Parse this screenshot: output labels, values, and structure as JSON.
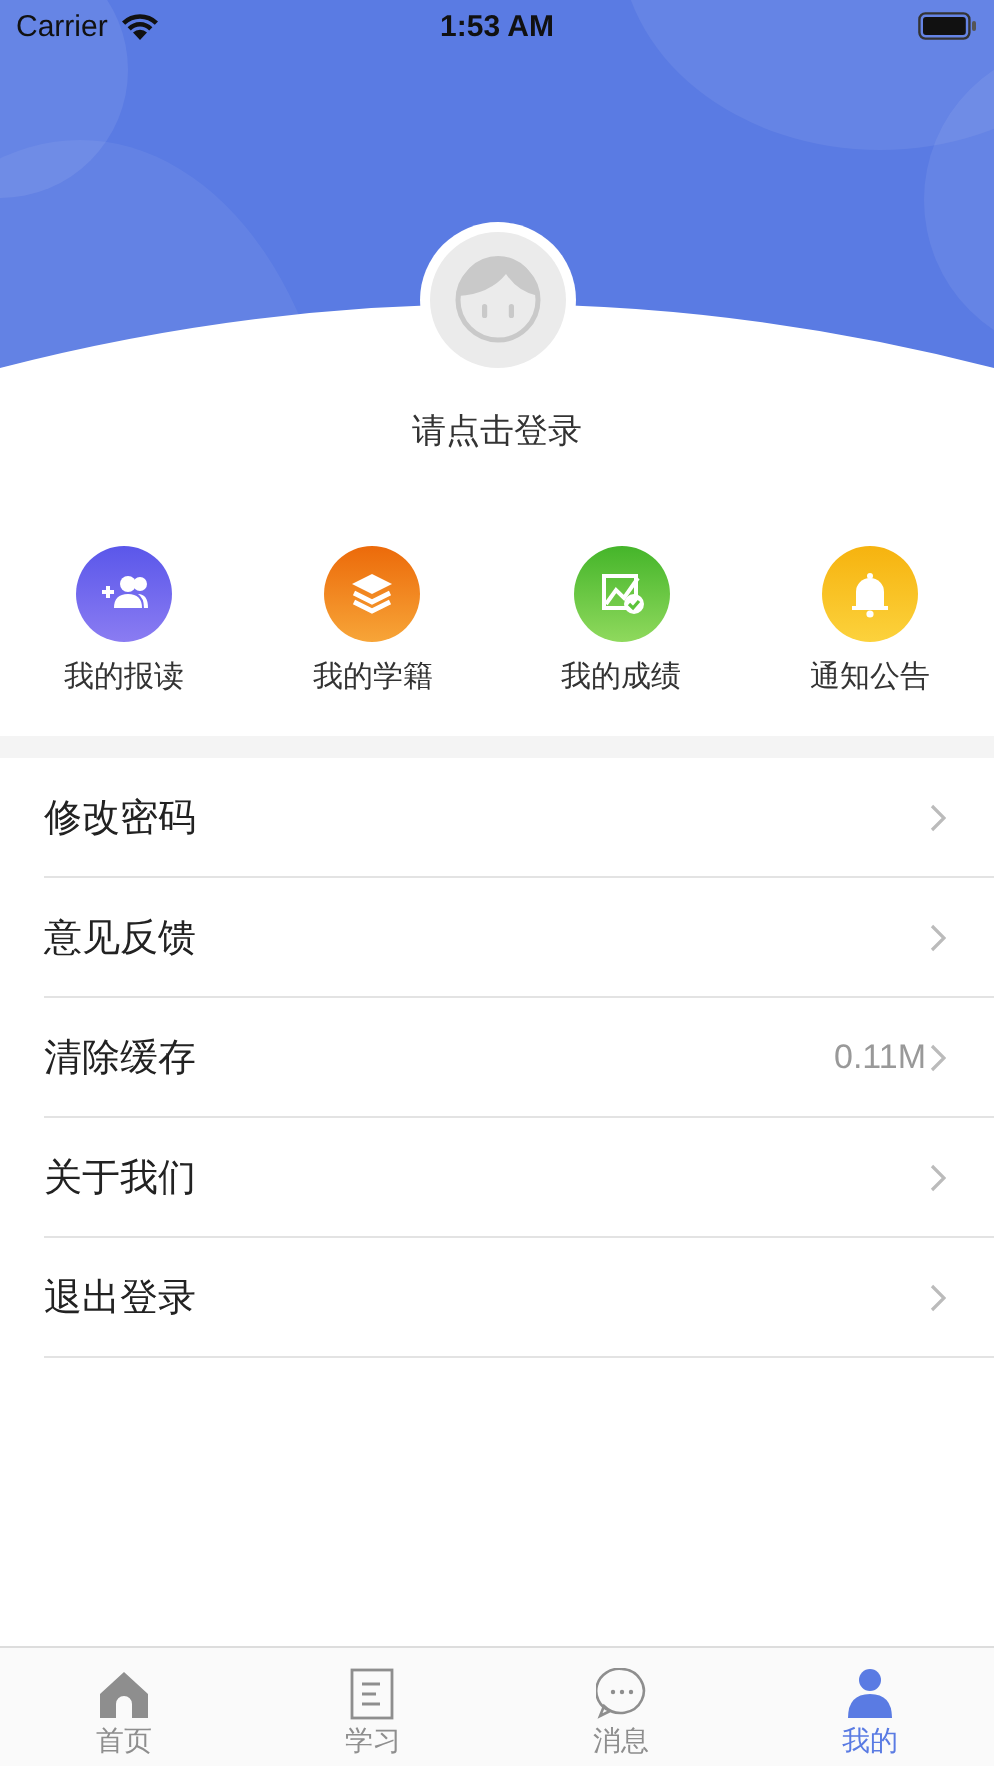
{
  "status_bar": {
    "carrier": "Carrier",
    "time": "1:53 AM"
  },
  "profile": {
    "login_prompt": "请点击登录"
  },
  "shortcuts": [
    {
      "kind": "enroll",
      "label": "我的报读"
    },
    {
      "kind": "records",
      "label": "我的学籍"
    },
    {
      "kind": "grades",
      "label": "我的成绩"
    },
    {
      "kind": "notice",
      "label": "通知公告"
    }
  ],
  "menu": [
    {
      "label": "修改密码"
    },
    {
      "label": "意见反馈"
    },
    {
      "label": "清除缓存",
      "value": "0.11M"
    },
    {
      "label": "关于我们"
    },
    {
      "label": "退出登录"
    }
  ],
  "tabs": [
    {
      "kind": "home",
      "label": "首页",
      "selected": false
    },
    {
      "kind": "study",
      "label": "学习",
      "selected": false
    },
    {
      "kind": "message",
      "label": "消息",
      "selected": false
    },
    {
      "kind": "me",
      "label": "我的",
      "selected": true
    }
  ]
}
